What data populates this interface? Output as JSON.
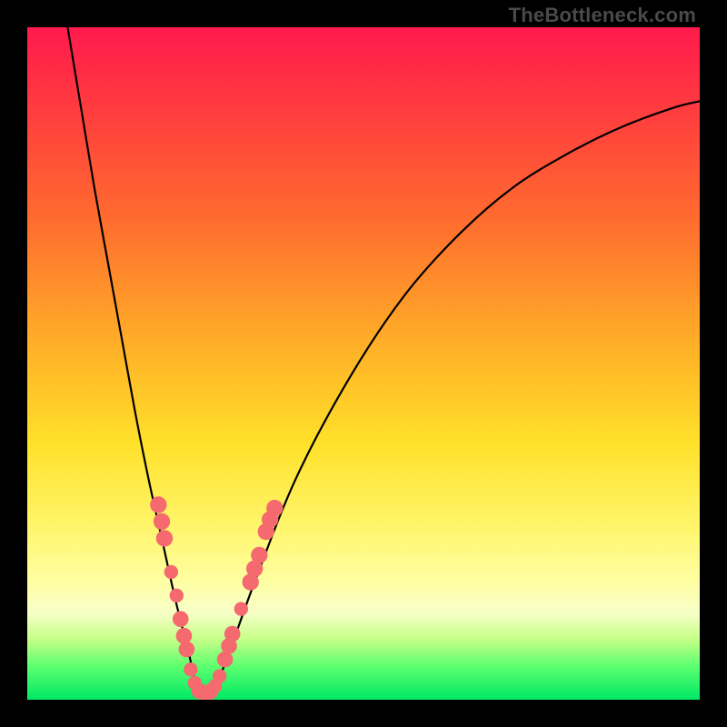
{
  "watermark": "TheBottleneck.com",
  "chart_data": {
    "type": "line",
    "title": "",
    "xlabel": "",
    "ylabel": "",
    "xlim": [
      0,
      100
    ],
    "ylim": [
      0,
      100
    ],
    "grid": false,
    "series": [
      {
        "name": "bottleneck-curve",
        "x": [
          6,
          8,
          10,
          12,
          14,
          16,
          18,
          20,
          22,
          24,
          25.5,
          27.5,
          30,
          34,
          40,
          48,
          56,
          64,
          72,
          80,
          88,
          96,
          100
        ],
        "y": [
          100,
          88,
          76,
          65,
          54,
          43,
          33,
          24,
          15,
          7,
          1,
          1,
          7,
          18,
          33,
          48,
          60,
          69,
          76,
          81,
          85,
          88,
          89
        ]
      }
    ],
    "markers": [
      {
        "x": 19.5,
        "y": 29.0,
        "r": 1.4
      },
      {
        "x": 20.0,
        "y": 26.5,
        "r": 1.4
      },
      {
        "x": 20.4,
        "y": 24.0,
        "r": 1.4
      },
      {
        "x": 21.4,
        "y": 19.0,
        "r": 1.0
      },
      {
        "x": 22.2,
        "y": 15.5,
        "r": 1.0
      },
      {
        "x": 22.8,
        "y": 12.0,
        "r": 1.3
      },
      {
        "x": 23.3,
        "y": 9.5,
        "r": 1.3
      },
      {
        "x": 23.7,
        "y": 7.5,
        "r": 1.3
      },
      {
        "x": 24.3,
        "y": 4.5,
        "r": 1.0
      },
      {
        "x": 24.9,
        "y": 2.5,
        "r": 1.0
      },
      {
        "x": 25.6,
        "y": 1.3,
        "r": 1.3
      },
      {
        "x": 26.4,
        "y": 1.0,
        "r": 1.3
      },
      {
        "x": 27.2,
        "y": 1.2,
        "r": 1.3
      },
      {
        "x": 27.9,
        "y": 2.0,
        "r": 1.0
      },
      {
        "x": 28.6,
        "y": 3.5,
        "r": 1.0
      },
      {
        "x": 29.4,
        "y": 6.0,
        "r": 1.3
      },
      {
        "x": 30.0,
        "y": 8.0,
        "r": 1.3
      },
      {
        "x": 30.5,
        "y": 9.8,
        "r": 1.3
      },
      {
        "x": 31.8,
        "y": 13.5,
        "r": 1.0
      },
      {
        "x": 33.2,
        "y": 17.5,
        "r": 1.4
      },
      {
        "x": 33.8,
        "y": 19.5,
        "r": 1.4
      },
      {
        "x": 34.5,
        "y": 21.5,
        "r": 1.4
      },
      {
        "x": 35.5,
        "y": 25.0,
        "r": 1.4
      },
      {
        "x": 36.1,
        "y": 26.8,
        "r": 1.4
      },
      {
        "x": 36.8,
        "y": 28.5,
        "r": 1.4
      }
    ],
    "marker_color": "#f46a6f"
  }
}
